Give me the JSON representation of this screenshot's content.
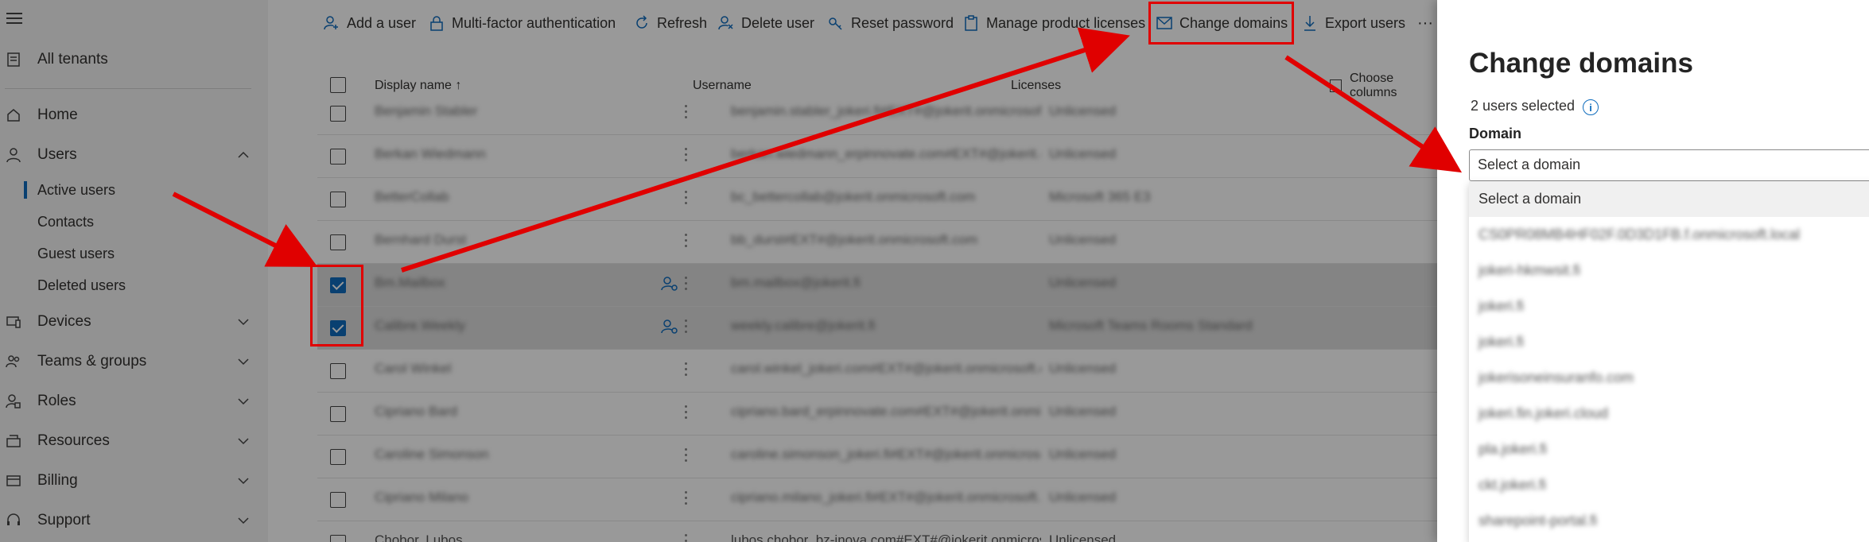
{
  "sidebar": {
    "top_item": "All tenants",
    "items": [
      {
        "label": "Home",
        "icon": "home-icon"
      },
      {
        "label": "Users",
        "icon": "user-icon",
        "expanded": true
      },
      {
        "label": "Devices",
        "icon": "devices-icon"
      },
      {
        "label": "Teams & groups",
        "icon": "teams-icon"
      },
      {
        "label": "Roles",
        "icon": "roles-icon"
      },
      {
        "label": "Resources",
        "icon": "resources-icon"
      },
      {
        "label": "Billing",
        "icon": "billing-icon"
      },
      {
        "label": "Support",
        "icon": "support-icon"
      }
    ],
    "users_sub": [
      "Active users",
      "Contacts",
      "Guest users",
      "Deleted users"
    ]
  },
  "toolbar": {
    "add_user": "Add a user",
    "mfa": "Multi-factor authentication",
    "refresh": "Refresh",
    "delete_user": "Delete user",
    "reset_password": "Reset password",
    "manage_licenses": "Manage product licenses",
    "change_domains": "Change domains",
    "export_users": "Export users",
    "more": "···"
  },
  "grid": {
    "col_display_name": "Display name ↑",
    "col_username": "Username",
    "col_licenses": "Licenses",
    "choose_columns": "Choose columns",
    "rows": [
      {
        "name": "Benjamin Stabler",
        "user": "benjamin.stabler_jokeri.fi#EXT#@jokerit.onmicrosoft.com",
        "lic": "Unlicensed",
        "checked": false
      },
      {
        "name": "Berkan Wiedmann",
        "user": "berkan.wiedmann_erpinnovate.com#EXT#@jokerit.onmicrosoft.com",
        "lic": "Unlicensed",
        "checked": false
      },
      {
        "name": "BetterCollab",
        "user": "bc_bettercollab@jokerit.onmicrosoft.com",
        "lic": "Microsoft 365 E3",
        "checked": false
      },
      {
        "name": "Bernhard Durst",
        "user": "bb_durst#EXT#@jokerit.onmicrosoft.com",
        "lic": "Unlicensed",
        "checked": false
      },
      {
        "name": "Bm.Mailbox",
        "user": "bm.mailbox@jokerit.fi",
        "lic": "Unlicensed",
        "checked": true
      },
      {
        "name": "Calibre.Weekly",
        "user": "weekly.calibre@jokerit.fi",
        "lic": "Microsoft Teams Rooms Standard",
        "checked": true
      },
      {
        "name": "Carol Winkel",
        "user": "carol.winkel_jokeri.com#EXT#@jokerit.onmicrosoft.com",
        "lic": "Unlicensed",
        "checked": false
      },
      {
        "name": "Cipriano Bard",
        "user": "cipriano.bard_erpinnovate.com#EXT#@jokerit.onmicrosoft.com",
        "lic": "Unlicensed",
        "checked": false
      },
      {
        "name": "Caroline Simonson",
        "user": "caroline.simonson_jokeri.fi#EXT#@jokerit.onmicrosoft.com",
        "lic": "Unlicensed",
        "checked": false
      },
      {
        "name": "Cipriano Milano",
        "user": "cipriano.milano_jokeri.fi#EXT#@jokerit.onmicrosoft.com",
        "lic": "Unlicensed",
        "checked": false
      },
      {
        "name": "Chobor, Lubos",
        "user": "lubos.chobor_bz-inova.com#EXT#@jokerit.onmicrosoft.com",
        "lic": "Unlicensed",
        "checked": false
      }
    ]
  },
  "panel": {
    "title": "Change domains",
    "selected_count": "2 users selected",
    "domain_label": "Domain",
    "select_placeholder": "Select a domain",
    "options": [
      "Select a domain",
      "CS0PR08MB4HF02F.0D3D1FB.f.onmicrosoft.local",
      "jokeri-hkmwsit.fi",
      "jokeri.fi",
      "jokeri.fi",
      "jokerisoneinsuranfo.com",
      "jokeri.fin.jokeri.cloud",
      "pla.jokeri.fi",
      "ckt.jokeri.fi",
      "sharepoint-portal.fi"
    ]
  },
  "annotation_color": "#e00000",
  "accent_color": "#0f6cbd"
}
